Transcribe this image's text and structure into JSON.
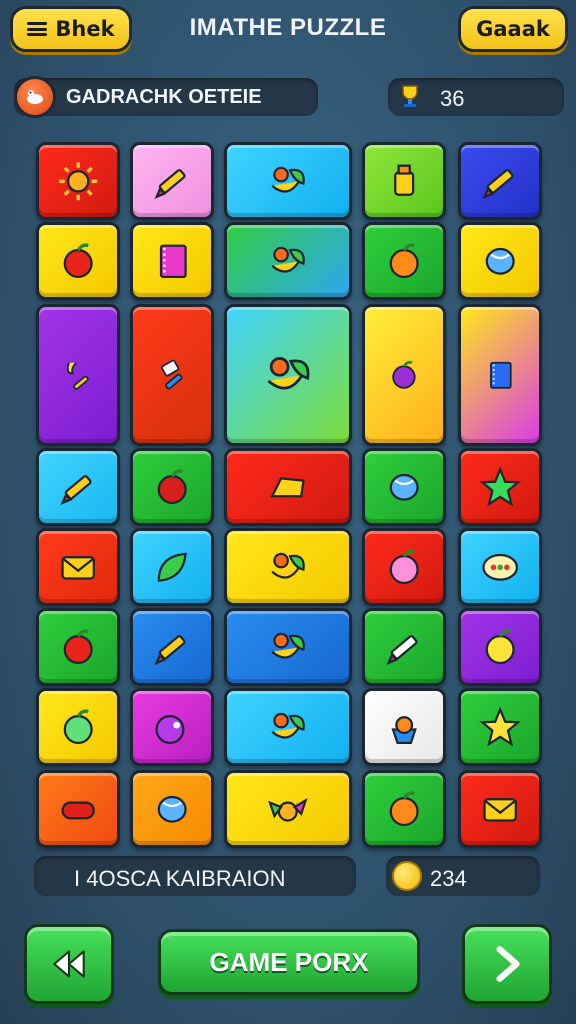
{
  "header": {
    "menu_label": "Bhek",
    "title": "IMATHE PUZZLE",
    "right_label": "Gaaak"
  },
  "info": {
    "player_name": "GADRACHK OETEIE",
    "score": "36"
  },
  "grid": {
    "tiles": [
      {
        "icon": "sun-icon",
        "bg": [
          "#ff2a1a",
          "#d11a10"
        ]
      },
      {
        "icon": "pencil-icon",
        "bg": [
          "#ffb6f0",
          "#f08fe0"
        ]
      },
      {
        "icon": "banana-leaf-icon",
        "bg": [
          "#3fd4ff",
          "#12b0f0"
        ]
      },
      {
        "icon": "glue-icon",
        "bg": [
          "#8fe63a",
          "#5bc61e"
        ]
      },
      {
        "icon": "pencil-icon",
        "bg": [
          "#3b4cf0",
          "#2330c8"
        ]
      },
      {
        "icon": "apple-icon",
        "bg": [
          "#ffe81a",
          "#f5c800"
        ]
      },
      {
        "icon": "notebook-icon",
        "bg": [
          "#ffe81a",
          "#f5c800"
        ]
      },
      {
        "icon": "flag-flower-icon",
        "bg": [
          "#33cc44",
          "#2ca7f0"
        ]
      },
      {
        "icon": "orange-icon",
        "bg": [
          "#2fcf3c",
          "#1ba52b"
        ]
      },
      {
        "icon": "balloon-icon",
        "bg": [
          "#ffe81a",
          "#f5c800"
        ]
      },
      {
        "icon": "banana-pencil-icon",
        "bg": [
          "#a233e8",
          "#7d1ed0"
        ]
      },
      {
        "icon": "eraser-pen-icon",
        "bg": [
          "#ff3a1a",
          "#d5300c"
        ]
      },
      {
        "icon": "flowers-icon",
        "bg": [
          "#3fd4ff",
          "#7ddc3a"
        ]
      },
      {
        "icon": "plum-icon",
        "bg": [
          "#ffee3a",
          "#ffb01a"
        ]
      },
      {
        "icon": "marker-book-icon",
        "bg": [
          "#ffe81a",
          "#d93be8"
        ]
      },
      {
        "icon": "marker-icon",
        "bg": [
          "#3fd4ff",
          "#1ab8ee"
        ]
      },
      {
        "icon": "cherry-icon",
        "bg": [
          "#2fcf3c",
          "#1ba52b"
        ]
      },
      {
        "icon": "cheese-icon",
        "bg": [
          "#ff2a1a",
          "#d11a10"
        ]
      },
      {
        "icon": "ball-icon",
        "bg": [
          "#2fcf3c",
          "#1ba52b"
        ]
      },
      {
        "icon": "star-arrow-icon",
        "bg": [
          "#ff2a1a",
          "#d11a10"
        ]
      },
      {
        "icon": "envelope-icon",
        "bg": [
          "#ff3a1a",
          "#e2280e"
        ]
      },
      {
        "icon": "leaf-icon",
        "bg": [
          "#3fd4ff",
          "#12b0f0"
        ]
      },
      {
        "icon": "grape-leaf-icon",
        "bg": [
          "#ffe81a",
          "#f5c800"
        ]
      },
      {
        "icon": "peach-icon",
        "bg": [
          "#ff2a1a",
          "#d11a10"
        ]
      },
      {
        "icon": "easter-egg-icon",
        "bg": [
          "#3fd4ff",
          "#12b0f0"
        ]
      },
      {
        "icon": "apple-icon",
        "bg": [
          "#2fcf3c",
          "#1ba52b"
        ]
      },
      {
        "icon": "pencil-icon",
        "bg": [
          "#2a8cf0",
          "#1668d0"
        ]
      },
      {
        "icon": "flower-banana-icon",
        "bg": [
          "#2a8cf0",
          "#1668d0"
        ]
      },
      {
        "icon": "crayon-icon",
        "bg": [
          "#2fcf3c",
          "#1ba52b"
        ]
      },
      {
        "icon": "lemon-icon",
        "bg": [
          "#a233e8",
          "#7d1ed0"
        ]
      },
      {
        "icon": "green-apple-icon",
        "bg": [
          "#ffe81a",
          "#f5c800"
        ]
      },
      {
        "icon": "bomb-icon",
        "bg": [
          "#e83adf",
          "#b81fc0"
        ]
      },
      {
        "icon": "banana-leaf-icon",
        "bg": [
          "#3fd4ff",
          "#12b0f0"
        ]
      },
      {
        "icon": "cupcake-icon",
        "bg": [
          "#ffffff",
          "#e8e8e8"
        ]
      },
      {
        "icon": "star-icon",
        "bg": [
          "#2fcf3c",
          "#1ba52b"
        ]
      },
      {
        "icon": "candy-icon",
        "bg": [
          "#ff7a1a",
          "#f04a10"
        ]
      },
      {
        "icon": "blue-ball-icon",
        "bg": [
          "#ffa81a",
          "#f58a00"
        ]
      },
      {
        "icon": "bird-icon",
        "bg": [
          "#ffe81a",
          "#f5c800"
        ]
      },
      {
        "icon": "orange-icon",
        "bg": [
          "#2fcf3c",
          "#1ba52b"
        ]
      },
      {
        "icon": "envelope-icon",
        "bg": [
          "#ff2a1a",
          "#d11a10"
        ]
      }
    ]
  },
  "footer": {
    "status_text": "I 4OSCA KAIBRAION",
    "coins": "234",
    "main_button": "GAME PORX"
  },
  "colors": {
    "background": "#2f5571",
    "accent_yellow": "#ffd82a",
    "accent_green": "#2fc04a"
  }
}
